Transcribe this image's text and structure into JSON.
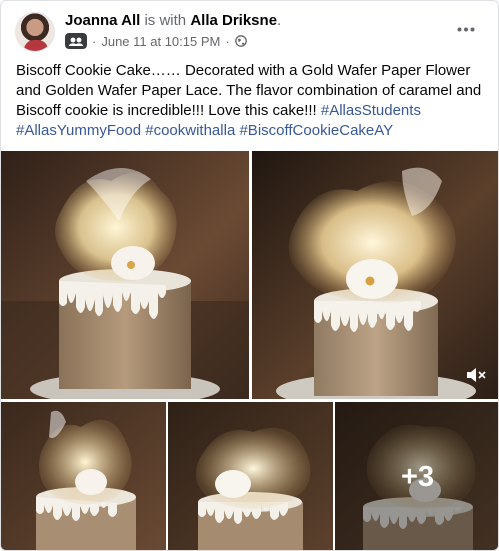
{
  "post": {
    "author": "Joanna All",
    "with_text": "is with",
    "tagged": "Alla Driksne",
    "tagged_suffix": ".",
    "timestamp": "June 11 at 10:15 PM",
    "separator": "·",
    "privacy_icon": "globe-icon",
    "group_icon": "group-badge-icon",
    "more_icon": "ellipsis-icon",
    "text": "Biscoff Cookie Cake…… Decorated with a Gold Wafer Paper Flower and Golden  Wafer Paper Lace.  The flavor combination of caramel and Biscoff cookie is incredible!!! Love this cake!!!",
    "hashtags": [
      "#AllasStudents",
      "#AllasYummyFood",
      "#cookwithalla",
      "#BiscoffCookieCakeAY"
    ]
  },
  "photos": {
    "extra_count": "+3",
    "mute_icon": "speaker-muted-icon"
  },
  "colors": {
    "text": "#050505",
    "muted": "#65676b",
    "link": "#385898"
  }
}
